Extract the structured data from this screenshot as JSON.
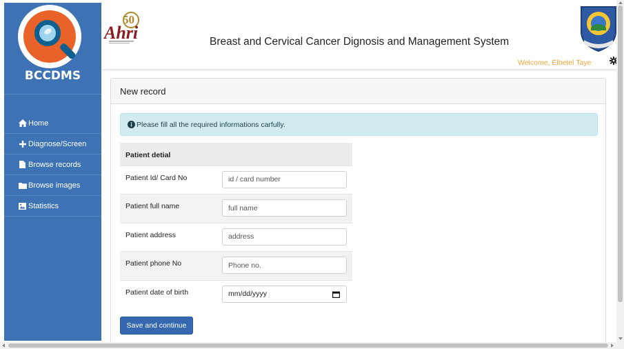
{
  "sidebar": {
    "brand": "BCCDMS",
    "items": [
      {
        "label": "Home",
        "icon": "home-icon"
      },
      {
        "label": "Diagnose/Screen",
        "icon": "plus-icon"
      },
      {
        "label": "Browse records",
        "icon": "file-icon"
      },
      {
        "label": "Browse images",
        "icon": "folder-icon"
      },
      {
        "label": "Statistics",
        "icon": "image-icon"
      }
    ]
  },
  "header": {
    "title": "Breast and Cervical Cancer Dignosis and Management System",
    "welcome": "Welcome, Elbetel Taye",
    "ahri_logo_text": "Ahri",
    "ahri_logo_number": "50"
  },
  "card": {
    "title": "New record",
    "alert": "Please fill all the required informations carfully.",
    "table_header": "Patient detial",
    "fields": [
      {
        "label": "Patient Id/ Card No",
        "placeholder": "id / card number"
      },
      {
        "label": "Patient full name",
        "placeholder": "full name"
      },
      {
        "label": "Patient address",
        "placeholder": "address"
      },
      {
        "label": "Patient phone No",
        "placeholder": "Phone no."
      },
      {
        "label": "Patient date of birth",
        "placeholder": "mm/dd/yyyy"
      }
    ],
    "submit_label": "Save and continue"
  },
  "colors": {
    "sidebar": "#3d73b5",
    "primary_button": "#3568b0",
    "alert_bg": "#d1ecf1",
    "welcome_text": "#f0a53a"
  }
}
